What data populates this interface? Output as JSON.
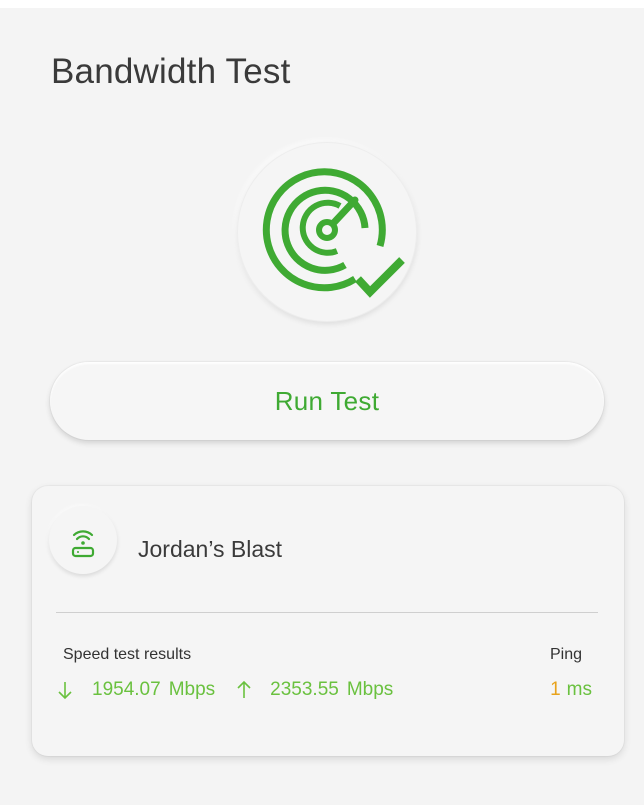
{
  "header": {
    "title": "Bandwidth Test"
  },
  "icons": {
    "gauge": "speedometer-check-icon",
    "router": "wifi-router-icon",
    "download": "arrow-down-icon",
    "upload": "arrow-up-icon"
  },
  "actions": {
    "run_test_label": "Run Test"
  },
  "network_card": {
    "name": "Jordan’s Blast",
    "results_label": "Speed test results",
    "download_value": "1954.07",
    "download_unit": "Mbps",
    "upload_value": "2353.55",
    "upload_unit": "Mbps",
    "ping_label": "Ping",
    "ping_value": "1",
    "ping_unit": "ms"
  },
  "colors": {
    "accent_green": "#3faa33",
    "value_green": "#6ac13f",
    "ping_orange": "#e8a31c",
    "background": "#f4f4f4"
  }
}
